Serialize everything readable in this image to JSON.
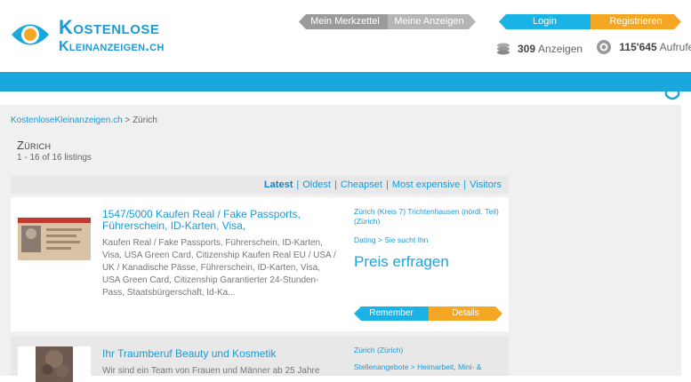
{
  "header": {
    "logo_line1": "Kostenlose",
    "logo_line2": "Kleinanzeigen.ch",
    "merkzettel_label": "Mein Merkzettel",
    "meine_anzeigen_label": "Meine Anzeigen",
    "login_label": "Login",
    "register_label": "Registrieren",
    "ads_count": "309",
    "ads_label": "Anzeigen",
    "views_count": "115'645",
    "views_label": "Aufrufe"
  },
  "breadcrumb": {
    "home": "KostenloseKleinanzeigen.ch",
    "separator": ">",
    "current": "Zürich"
  },
  "page": {
    "title": "Zürich",
    "count_text": "1 - 16 of 16 listings"
  },
  "sort": {
    "options": [
      "Latest",
      "Oldest",
      "Cheapset",
      "Most expensive",
      "Visitors"
    ],
    "active": "Latest"
  },
  "listings": [
    {
      "title": "1547/5000 Kaufen Real / Fake Passports, Führerschein, ID-Karten, Visa,",
      "description": "Kaufen Real / Fake Passports, Führerschein, ID-Karten, Visa, USA Green Card, Citizenship Kaufen Real EU / USA / UK / Kanadische Pässe, Führerschein, ID-Karten, Visa, USA Green Card, Citizenship Garantierter 24-Stunden-Pass, Staatsbürgerschaft, Id-Ka...",
      "location": "Zürich (Kreis 7) Trichtenhausen (nördl. Teil) (Zürich)",
      "category": "Dating > Sie sucht Ihn",
      "price": "Preis erfragen",
      "remember_label": "Remember",
      "details_label": "Details"
    },
    {
      "title": "Ihr Traumberuf Beauty und Kosmetik",
      "description": "Wir sind ein Team von Frauen und Männer ab 25 Jahre",
      "location": "Zürich (Zürich)",
      "category": "Stellenangebote > Heimarbeit, Mini- &"
    }
  ],
  "colors": {
    "brand_blue": "#1aa8dc",
    "accent_orange": "#f5a623",
    "link_blue": "#1a9ad6"
  }
}
